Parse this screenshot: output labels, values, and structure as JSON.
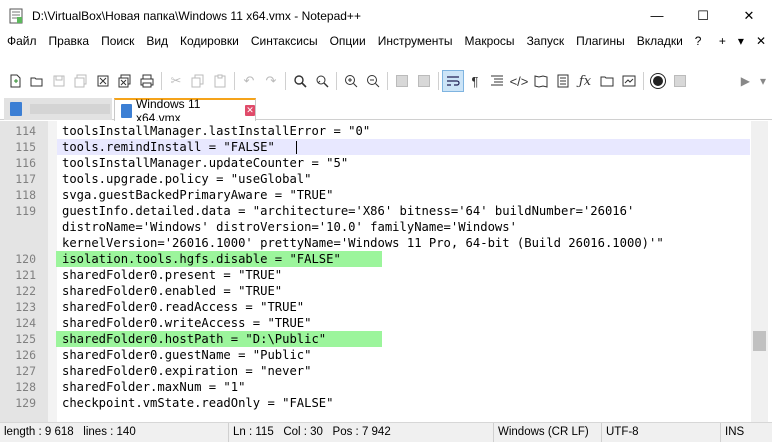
{
  "window": {
    "title": "D:\\VirtualBox\\Новая папка\\Windows 11 x64.vmx - Notepad++",
    "minimize": "—",
    "maximize": "☐",
    "close": "✕"
  },
  "menu": {
    "items": [
      "Файл",
      "Правка",
      "Поиск",
      "Вид",
      "Кодировки",
      "Синтаксисы",
      "Опции",
      "Инструменты",
      "Макросы",
      "Запуск",
      "Плагины",
      "Вкладки",
      "?"
    ],
    "right_plus": "+",
    "right_down": "▾",
    "right_close": "✕"
  },
  "toolbar": {
    "right_arrow": "▶",
    "right_down": "▾"
  },
  "tabs": {
    "active_label": "Windows 11 x64.vmx",
    "close_glyph": "✕"
  },
  "editor": {
    "lines": [
      {
        "n": "114",
        "text": "toolsInstallManager.lastInstallError = \"0\""
      },
      {
        "n": "115",
        "text": "tools.remindInstall = \"FALSE\""
      },
      {
        "n": "116",
        "text": "toolsInstallManager.updateCounter = \"5\""
      },
      {
        "n": "117",
        "text": "tools.upgrade.policy = \"useGlobal\""
      },
      {
        "n": "118",
        "text": "svga.guestBackedPrimaryAware = \"TRUE\""
      },
      {
        "n": "119",
        "text": "guestInfo.detailed.data = \"architecture='X86' bitness='64' buildNumber='26016'"
      },
      {
        "n": "",
        "text": "distroName='Windows' distroVersion='10.0' familyName='Windows'"
      },
      {
        "n": "",
        "text": "kernelVersion='26016.1000' prettyName='Windows 11 Pro, 64-bit (Build 26016.1000)'\""
      },
      {
        "n": "120",
        "text": "isolation.tools.hgfs.disable = \"FALSE\""
      },
      {
        "n": "121",
        "text": "sharedFolder0.present = \"TRUE\""
      },
      {
        "n": "122",
        "text": "sharedFolder0.enabled = \"TRUE\""
      },
      {
        "n": "123",
        "text": "sharedFolder0.readAccess = \"TRUE\""
      },
      {
        "n": "124",
        "text": "sharedFolder0.writeAccess = \"TRUE\""
      },
      {
        "n": "125",
        "text": "sharedFolder0.hostPath = \"D:\\Public\""
      },
      {
        "n": "126",
        "text": "sharedFolder0.guestName = \"Public\""
      },
      {
        "n": "127",
        "text": "sharedFolder0.expiration = \"never\""
      },
      {
        "n": "128",
        "text": "sharedFolder.maxNum = \"1\""
      },
      {
        "n": "129",
        "text": "checkpoint.vmState.readOnly = \"FALSE\""
      }
    ]
  },
  "status": {
    "length": "length : 9 618",
    "lines": "lines : 140",
    "ln": "Ln : 115",
    "col": "Col : 30",
    "pos": "Pos : 7 942",
    "eol": "Windows (CR LF)",
    "encoding": "UTF-8",
    "mode": "INS"
  },
  "colors": {
    "highlight": "#9cf59c",
    "current_line": "#e8e8ff",
    "tab_accent": "#f5a31a"
  }
}
